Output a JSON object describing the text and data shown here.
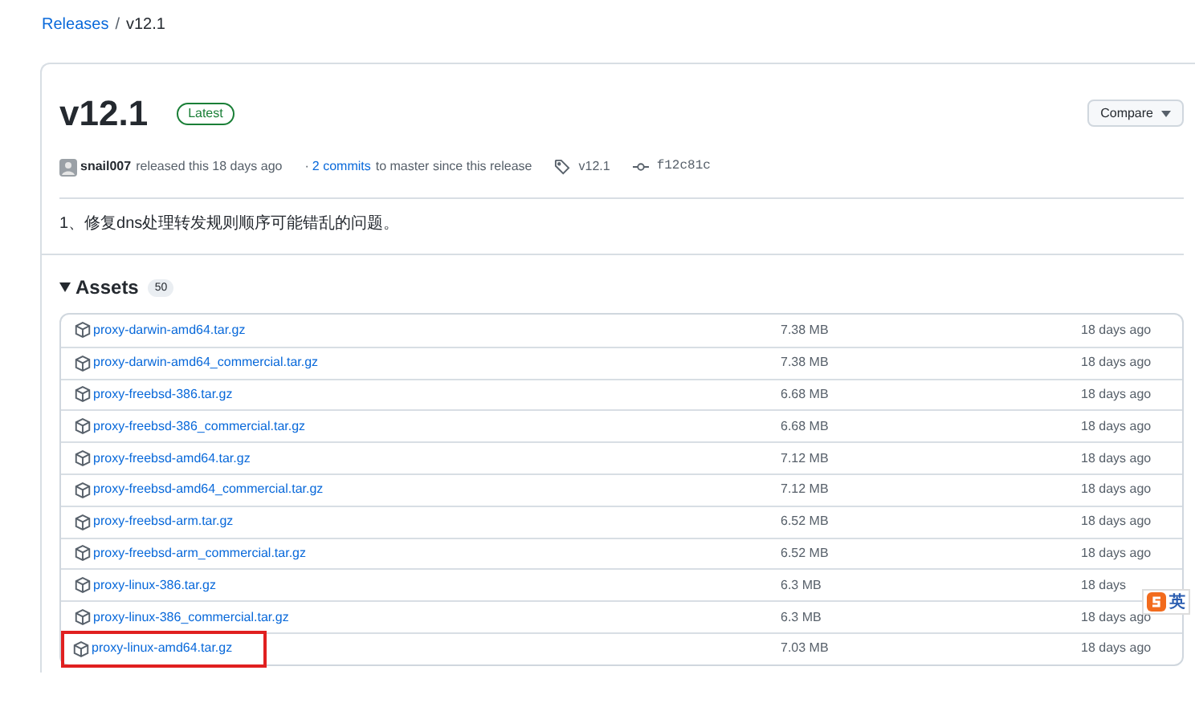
{
  "breadcrumb": {
    "link": "Releases",
    "separator": "/",
    "current": "v12.1"
  },
  "release": {
    "title": "v12.1",
    "badge": "Latest",
    "compare_button": "Compare",
    "author": "snail007",
    "released_text": "released this 18 days ago",
    "commits_prefix": "·",
    "commits_link": "2 commits",
    "commits_text": "to master since this release",
    "tag": "v12.1",
    "commit": "f12c81c",
    "notes": "1、修复dns处理转发规则顺序可能错乱的问题。"
  },
  "assets": {
    "title": "Assets",
    "count": "50",
    "expanded": true,
    "items": [
      {
        "name": "proxy-darwin-amd64.tar.gz",
        "size": "7.38 MB",
        "date": "18 days ago",
        "highlighted": false
      },
      {
        "name": "proxy-darwin-amd64_commercial.tar.gz",
        "size": "7.38 MB",
        "date": "18 days ago",
        "highlighted": false
      },
      {
        "name": "proxy-freebsd-386.tar.gz",
        "size": "6.68 MB",
        "date": "18 days ago",
        "highlighted": false
      },
      {
        "name": "proxy-freebsd-386_commercial.tar.gz",
        "size": "6.68 MB",
        "date": "18 days ago",
        "highlighted": false
      },
      {
        "name": "proxy-freebsd-amd64.tar.gz",
        "size": "7.12 MB",
        "date": "18 days ago",
        "highlighted": false
      },
      {
        "name": "proxy-freebsd-amd64_commercial.tar.gz",
        "size": "7.12 MB",
        "date": "18 days ago",
        "highlighted": false
      },
      {
        "name": "proxy-freebsd-arm.tar.gz",
        "size": "6.52 MB",
        "date": "18 days ago",
        "highlighted": false
      },
      {
        "name": "proxy-freebsd-arm_commercial.tar.gz",
        "size": "6.52 MB",
        "date": "18 days ago",
        "highlighted": false
      },
      {
        "name": "proxy-linux-386.tar.gz",
        "size": "6.3 MB",
        "date": "18 days",
        "highlighted": false
      },
      {
        "name": "proxy-linux-386_commercial.tar.gz",
        "size": "6.3 MB",
        "date": "18 days ago",
        "highlighted": false
      },
      {
        "name": "proxy-linux-amd64.tar.gz",
        "size": "7.03 MB",
        "date": "18 days ago",
        "highlighted": true
      }
    ]
  },
  "ime_indicator": {
    "label": "英"
  }
}
